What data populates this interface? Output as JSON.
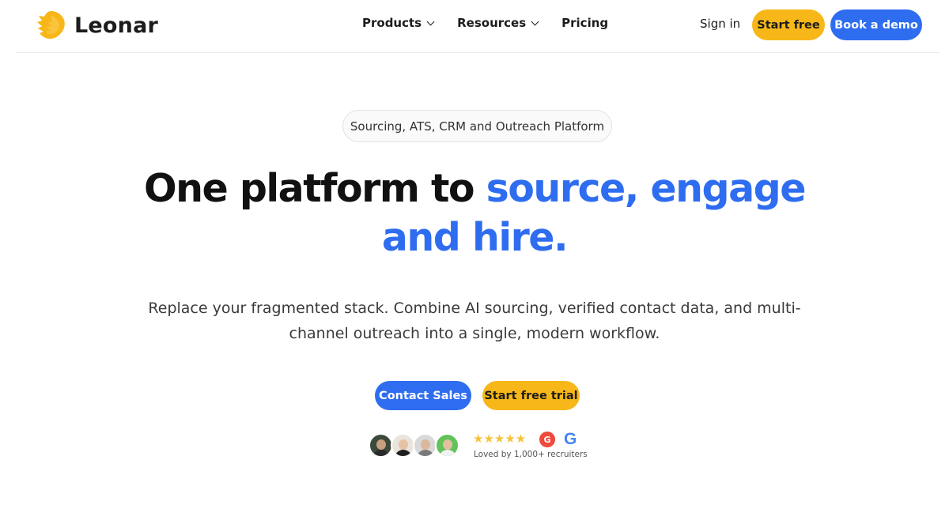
{
  "brand": {
    "name": "Leonar",
    "logo_color": "#f7b718"
  },
  "nav": {
    "items": [
      {
        "label": "Products",
        "has_dropdown": true
      },
      {
        "label": "Resources",
        "has_dropdown": true
      },
      {
        "label": "Pricing",
        "has_dropdown": false
      }
    ]
  },
  "header_actions": {
    "sign_in": "Sign in",
    "start_free": "Start free",
    "book_demo": "Book a demo"
  },
  "hero": {
    "pill": "Sourcing, ATS, CRM and Outreach Platform",
    "headline_plain": "One platform to ",
    "headline_accent_line1": "source, engage",
    "headline_accent_line2": "and hire.",
    "subtext": "Replace your fragmented stack. Combine AI sourcing, verified contact data, and multi-channel outreach into a single, modern workflow.",
    "cta_primary": "Contact Sales",
    "cta_secondary": "Start free trial"
  },
  "social_proof": {
    "stars": "★★★★★",
    "g2_badge": "G",
    "google_badge": "G",
    "caption": "Loved by 1,000+ recruiters",
    "avatar_count": 4
  },
  "colors": {
    "accent_blue": "#2f6df0",
    "accent_yellow": "#f7b718",
    "star": "#f5c33b"
  }
}
